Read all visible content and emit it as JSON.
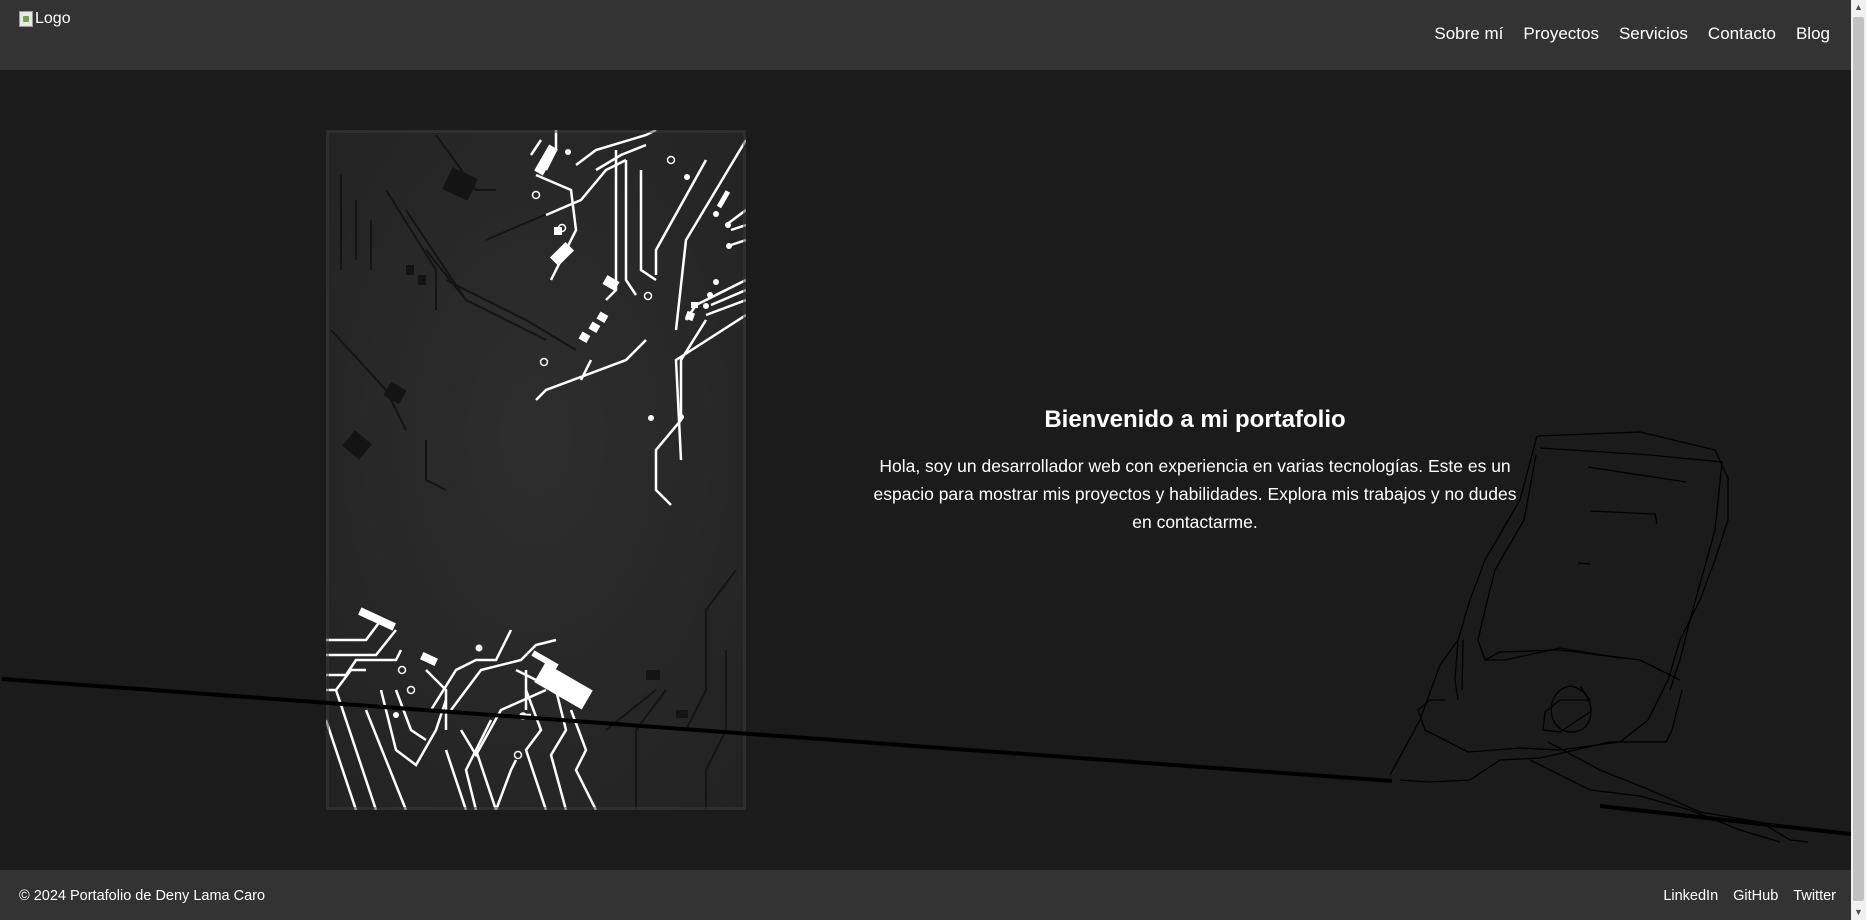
{
  "header": {
    "logo_alt": "Logo",
    "nav": [
      "Sobre mí",
      "Proyectos",
      "Servicios",
      "Contacto",
      "Blog"
    ]
  },
  "hero": {
    "title": "Bienvenido a mi portafolio",
    "text": "Hola, soy un desarrollador web con experiencia en varias tecnologías. Este es un espacio para mostrar mis proyectos y habilidades. Explora mis trabajos y no dudes en contactarme."
  },
  "footer": {
    "copyright": "© 2024 Portafolio de Deny Lama Caro",
    "social": [
      "LinkedIn",
      "GitHub",
      "Twitter"
    ]
  },
  "icons": {
    "broken_image": "broken-image-icon",
    "scroll_up": "chevron-up-icon",
    "scroll_down": "chevron-down-icon"
  },
  "colors": {
    "header_bg": "#333333",
    "page_bg": "#1b1b1b",
    "text": "#ffffff"
  }
}
